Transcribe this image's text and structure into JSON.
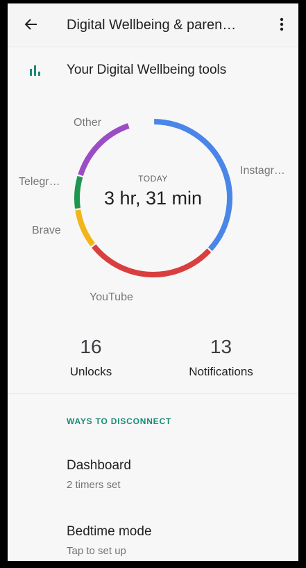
{
  "appbar": {
    "title": "Digital Wellbeing & paren…"
  },
  "tools": {
    "title": "Your Digital Wellbeing tools"
  },
  "summary": {
    "today_label": "TODAY",
    "total_time": "3 hr, 31 min"
  },
  "usage_segments": [
    {
      "app": "Instagr…",
      "fraction": 0.368,
      "color": "#4a86e8"
    },
    {
      "app": "YouTube",
      "fraction": 0.276,
      "color": "#d93f3f"
    },
    {
      "app": "Brave",
      "fraction": 0.083,
      "color": "#f2b519"
    },
    {
      "app": "Telegr…",
      "fraction": 0.07,
      "color": "#1e9650"
    },
    {
      "app": "Other",
      "fraction": 0.152,
      "color": "#9c4dc4"
    }
  ],
  "stats": {
    "unlocks": {
      "value": "16",
      "label": "Unlocks"
    },
    "notifications": {
      "value": "13",
      "label": "Notifications"
    }
  },
  "ways_to_disconnect": {
    "header": "WAYS TO DISCONNECT",
    "items": [
      {
        "title": "Dashboard",
        "subtitle": "2 timers set"
      },
      {
        "title": "Bedtime mode",
        "subtitle": "Tap to set up"
      }
    ]
  },
  "colors": {
    "accent": "#1a8a78"
  }
}
